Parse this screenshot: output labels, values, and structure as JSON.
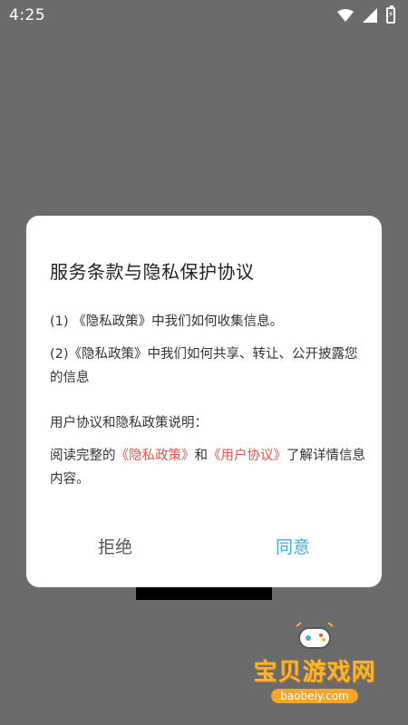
{
  "status_bar": {
    "time": "4:25",
    "icons": [
      "wifi-icon",
      "signal-icon",
      "battery-charging-icon"
    ]
  },
  "dialog": {
    "title": "服务条款与隐私保护协议",
    "item1": "(1) 《隐私政策》中我们如何收集信息。",
    "item2": "(2)《隐私政策》中我们如何共享、转让、公开披露您的信息",
    "section_label": "用户协议和隐私政策说明：",
    "full_text_prefix": "阅读完整的",
    "privacy_link": "《隐私政策》",
    "conjunction": "和",
    "user_agreement_link": "《用户协议》",
    "full_text_suffix": "了解详情信息内容。",
    "reject_label": "拒绝",
    "agree_label": "同意"
  },
  "colors": {
    "link": "#e8524a",
    "agree": "#3fb0d8",
    "overlay": "#6b6b6b"
  },
  "watermark": {
    "name": "宝贝游戏网",
    "url": "baobeiy.com"
  }
}
